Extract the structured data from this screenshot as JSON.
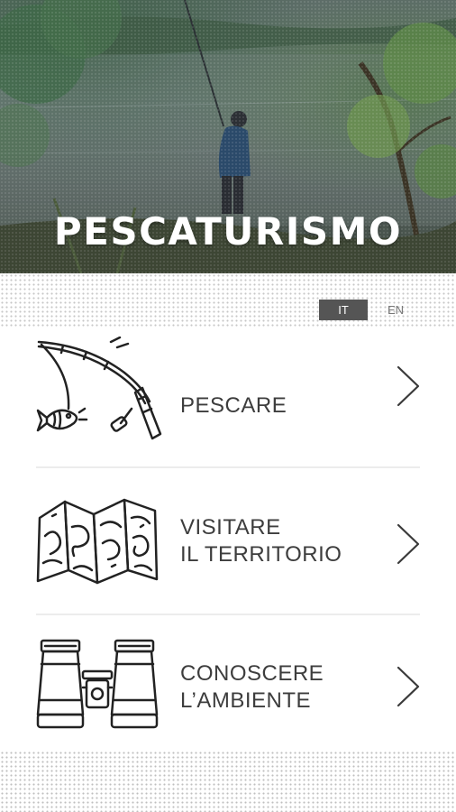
{
  "header": {
    "title": "PESCATURISMO",
    "image_icon": "fisherman-lake-photo"
  },
  "language": {
    "options": [
      {
        "code": "IT",
        "active": true
      },
      {
        "code": "EN",
        "active": false
      }
    ]
  },
  "menu": {
    "items": [
      {
        "label": "PESCARE",
        "icon": "fishing-rod-icon"
      },
      {
        "label": "VISITARE\nIL TERRITORIO",
        "icon": "map-icon"
      },
      {
        "label": "CONOSCERE\nL’AMBIENTE",
        "icon": "binoculars-icon"
      }
    ]
  },
  "colors": {
    "text": "#3d3d3d",
    "active_lang_bg": "#555555",
    "divider": "#ececec"
  }
}
